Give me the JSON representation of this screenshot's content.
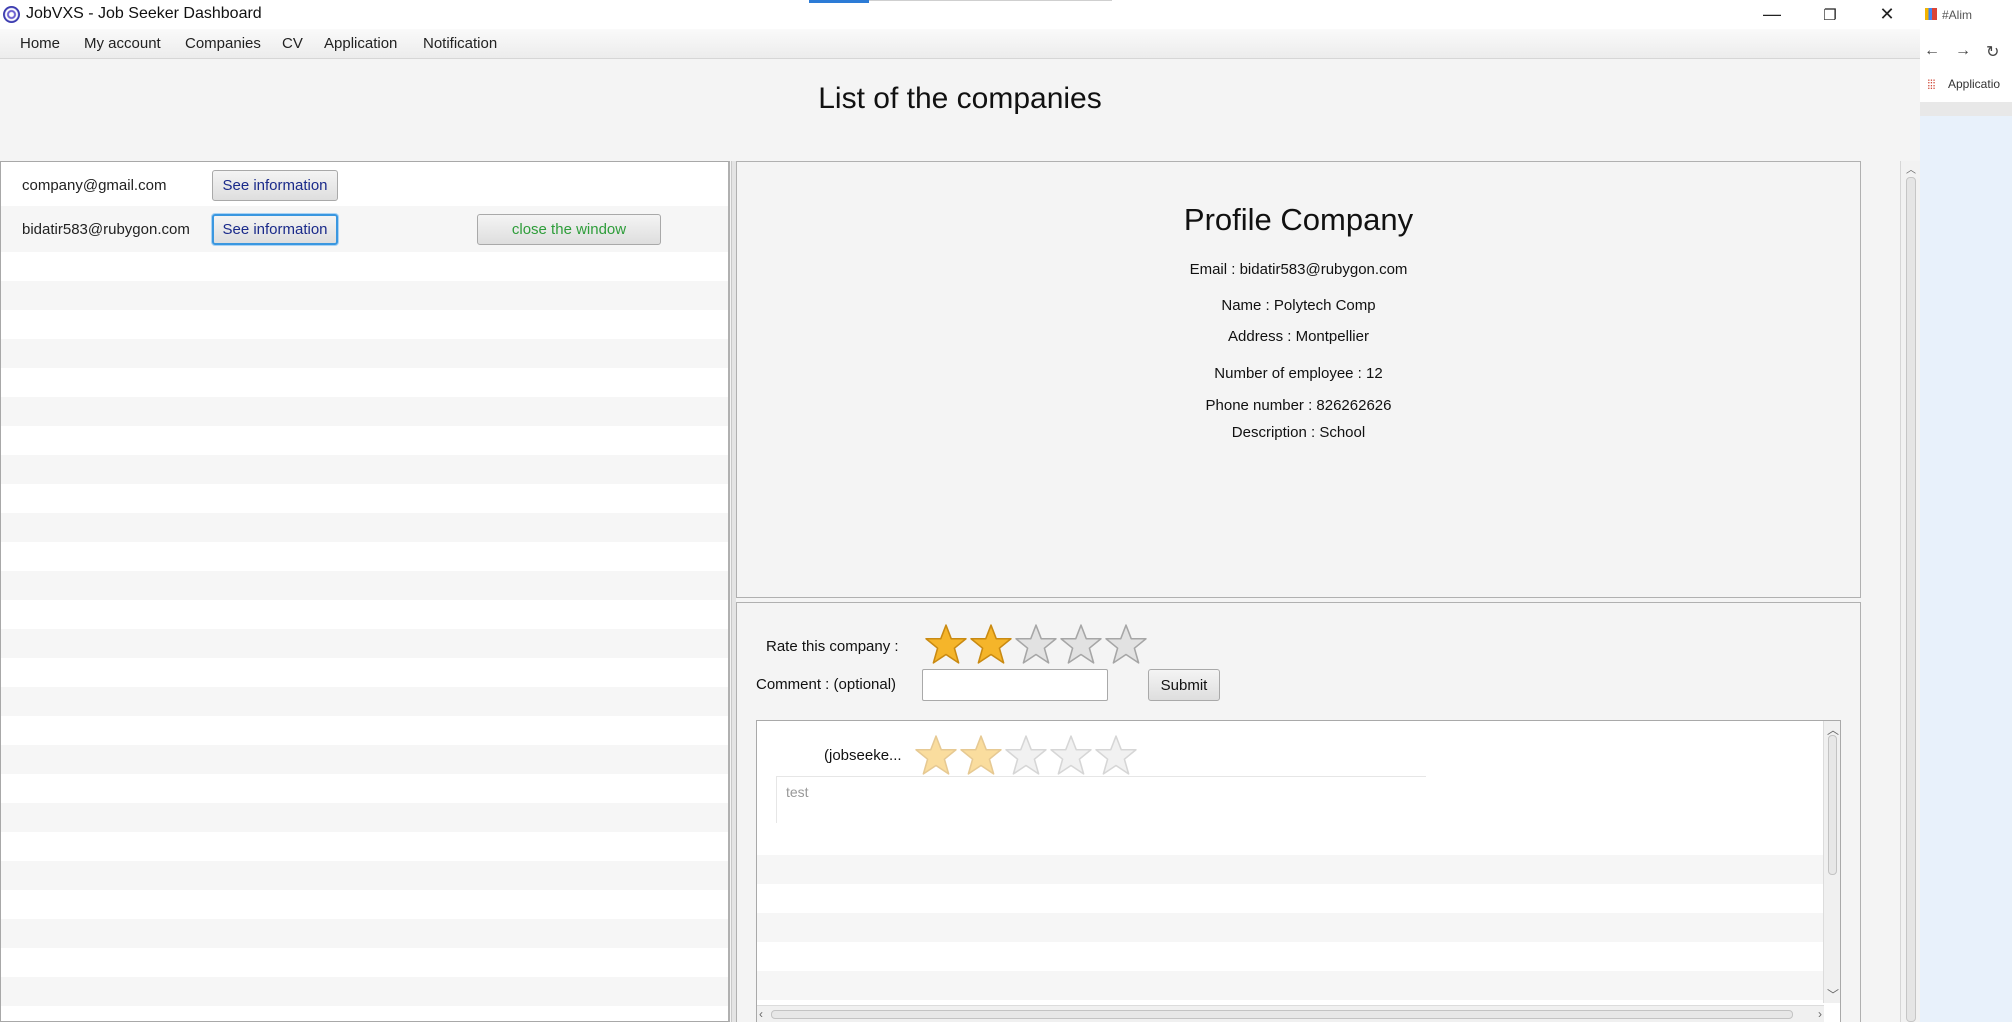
{
  "window": {
    "title": "JobVXS - Job Seeker Dashboard",
    "controls": {
      "minimize": "—",
      "restore": "❐",
      "close": "✕"
    }
  },
  "menu": [
    "Home",
    "My account",
    "Companies",
    "CV",
    "Application",
    "Notification"
  ],
  "page_title": "List of the companies",
  "companies": [
    {
      "email": "company@gmail.com",
      "button": "See information"
    },
    {
      "email": "bidatir583@rubygon.com",
      "button": "See information"
    }
  ],
  "close_button": "close the window",
  "profile": {
    "title": "Profile Company",
    "email": "Email : bidatir583@rubygon.com",
    "name": "Name : Polytech Comp",
    "address": "Address : Montpellier",
    "employees": "Number of employee : 12",
    "phone": "Phone number : 826262626",
    "description": "Description : School"
  },
  "rating": {
    "label": "Rate this company :",
    "selected_stars": 2,
    "max_stars": 5,
    "comment_label": "Comment : (optional)",
    "comment_value": "",
    "submit": "Submit"
  },
  "comments": [
    {
      "author": "(jobseeke...",
      "stars": 2,
      "text": "test"
    }
  ],
  "background_browser": {
    "tab": "#Alim",
    "bookmark": "Applicatio"
  },
  "colors": {
    "star_filled": "#f5b52a",
    "star_empty": "#e2e2e2",
    "focus": "#3a97e0",
    "close_text": "#2e9d3a"
  }
}
